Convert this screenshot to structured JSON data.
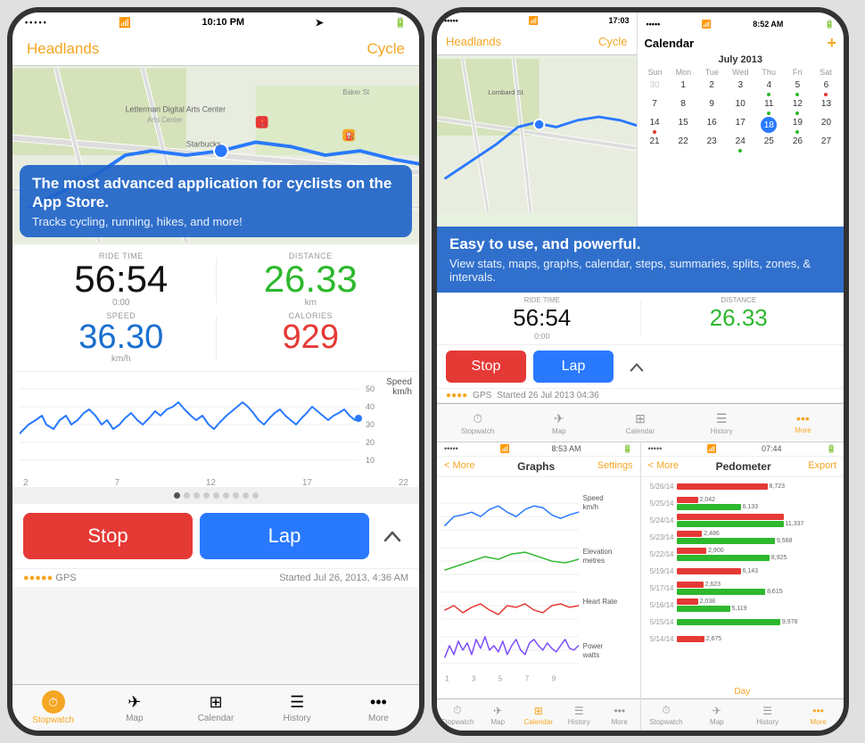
{
  "leftPhone": {
    "statusBar": {
      "dots": "•••••",
      "wifi": "wifi",
      "time": "10:10 PM",
      "location": "➤",
      "battery": "▮▮▮"
    },
    "navBar": {
      "left": "Headlands",
      "right": "Cycle"
    },
    "callout": {
      "mainText": "The most advanced application for cyclists on the App Store.",
      "subText": "Tracks cycling, running, hikes, and more!"
    },
    "stats": {
      "rideTimeLabel": "RIDE TIME",
      "rideTimeValue": "56:54",
      "rideTimeSub": "0:00",
      "distanceLabel": "DISTANCE",
      "distanceValue": "26.33",
      "distanceSub": "km",
      "speedLabel": "SPEED",
      "speedValue": "36.30",
      "speedSub": "km/h",
      "caloriesLabel": "CALORIES",
      "caloriesValue": "929"
    },
    "chart": {
      "label": "Speed\nkm/h",
      "yLabels": [
        "50",
        "40",
        "30",
        "20",
        "10"
      ],
      "xLabels": [
        "2",
        "7",
        "12",
        "17",
        "22"
      ]
    },
    "controls": {
      "stopLabel": "Stop",
      "lapLabel": "Lap"
    },
    "gpsBar": {
      "dots": "●●●●●",
      "gpsLabel": "GPS",
      "startedLabel": "Started Jul 26, 2013, 4:36 AM"
    },
    "tabBar": {
      "tabs": [
        {
          "id": "stopwatch",
          "label": "Stopwatch",
          "active": true
        },
        {
          "id": "map",
          "label": "Map",
          "active": false
        },
        {
          "id": "calendar",
          "label": "Calendar",
          "active": false
        },
        {
          "id": "history",
          "label": "History",
          "active": false
        },
        {
          "id": "more",
          "label": "More",
          "active": false
        }
      ]
    }
  },
  "rightPhone": {
    "topLeft": {
      "statusBar": {
        "dots": "•••••",
        "wifi": "wifi",
        "time": "17:03"
      },
      "navBar": {
        "left": "Headlands",
        "right": "Cycle"
      }
    },
    "topRight": {
      "statusBar": {
        "dots": "•••••",
        "wifi": "wifi",
        "time": "8:52 AM"
      },
      "calendarTitle": "Calendar",
      "monthYear": "July 2013",
      "dayHeaders": [
        "Sun",
        "Mon",
        "Tue",
        "Wed",
        "Thu",
        "Fri",
        "Sat"
      ],
      "weeks": [
        [
          {
            "n": "30",
            "prev": true
          },
          {
            "n": "1"
          },
          {
            "n": "2"
          },
          {
            "n": "3"
          },
          {
            "n": "4",
            "dot": "green"
          },
          {
            "n": "5",
            "dot": "green"
          },
          {
            "n": "6",
            "dot": "red"
          }
        ],
        [
          {
            "n": "7"
          },
          {
            "n": "8"
          },
          {
            "n": "9"
          },
          {
            "n": "10"
          },
          {
            "n": "11",
            "dot": "green"
          },
          {
            "n": "12",
            "dot": "green"
          },
          {
            "n": "13"
          }
        ],
        [
          {
            "n": "14",
            "dot": "red"
          },
          {
            "n": "15"
          },
          {
            "n": "16"
          },
          {
            "n": "17"
          },
          {
            "n": "18",
            "today": true
          },
          {
            "n": "19",
            "dot": "green"
          },
          {
            "n": "20"
          }
        ],
        [
          {
            "n": "21"
          },
          {
            "n": "22"
          },
          {
            "n": "23"
          },
          {
            "n": "24",
            "dot": "green"
          },
          {
            "n": "25"
          },
          {
            "n": "26"
          },
          {
            "n": "27"
          }
        ]
      ]
    },
    "callout": {
      "mainText": "Easy to use, and powerful.",
      "subText": "View stats, maps, graphs, calendar, steps, summaries, splits, zones, & intervals."
    },
    "rideStats": {
      "rideTimeValue": "56:54",
      "distanceValue": "26.33"
    },
    "controls": {
      "stopLabel": "Stop",
      "lapLabel": "Lap"
    },
    "gpsBar": {
      "dots": "●●●●",
      "gpsLabel": "GPS",
      "startedLabel": "Started 26 Jul 2013 04:36"
    },
    "bottomLeft": {
      "statusBar": {
        "dots": "•••••",
        "wifi": "wifi",
        "time": "8:53 AM"
      },
      "back": "< More",
      "title": "Graphs",
      "settings": "Settings"
    },
    "bottomRight": {
      "statusBar": {
        "dots": "•••••",
        "wifi": "wifi",
        "time": "07:44"
      },
      "back": "< More",
      "title": "Pedometer",
      "export": "Export",
      "bars": [
        {
          "date": "5/26/14",
          "red": 85,
          "redVal": "8,723",
          "green": 0,
          "greenVal": ""
        },
        {
          "date": "5/25/14",
          "red": 20,
          "redVal": "2,042",
          "green": 60,
          "greenVal": "6,133"
        },
        {
          "date": "5/24/14",
          "red": 100,
          "redVal": "",
          "green": 100,
          "greenVal": "11,337"
        },
        {
          "date": "5/23/14",
          "red": 24,
          "redVal": "2,486",
          "green": 92,
          "greenVal": "9,568"
        },
        {
          "date": "5/22/14",
          "red": 28,
          "redVal": "2,900",
          "green": 87,
          "greenVal": "8,925"
        },
        {
          "date": "5/19/14",
          "red": 60,
          "redVal": "6,143",
          "green": 0,
          "greenVal": ""
        },
        {
          "date": "5/17/14",
          "red": 25,
          "redVal": "2,623",
          "green": 83,
          "greenVal": "8,615"
        },
        {
          "date": "5/16/14",
          "red": 20,
          "redVal": "2,038",
          "green": 50,
          "greenVal": "5,119"
        },
        {
          "date": "5/15/14",
          "red": 0,
          "redVal": "",
          "green": 97,
          "greenVal": "9,978"
        },
        {
          "date": "5/14/14",
          "red": 26,
          "redVal": "2,675",
          "green": 0,
          "greenVal": ""
        }
      ]
    },
    "bottomTabBar": {
      "tabs": [
        {
          "label": "Stopwatch"
        },
        {
          "label": "Map"
        },
        {
          "label": "History"
        },
        {
          "label": "More"
        }
      ]
    }
  }
}
